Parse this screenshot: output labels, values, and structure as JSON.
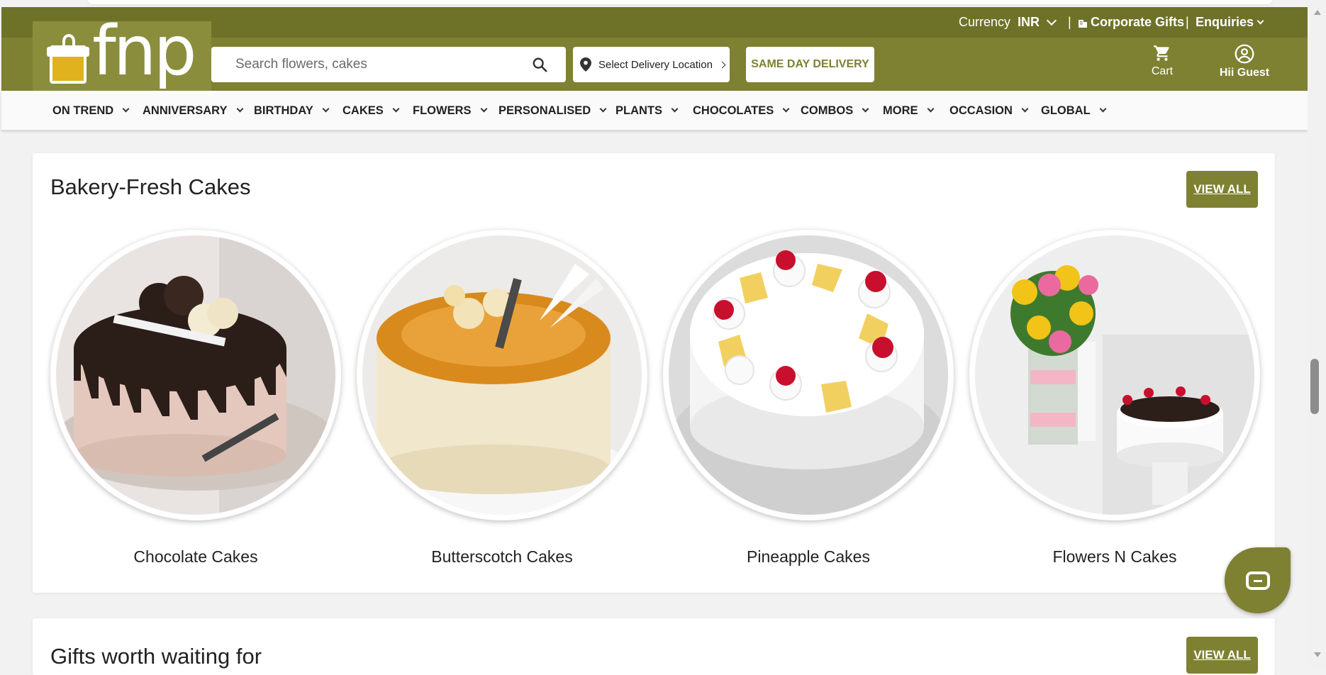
{
  "header": {
    "logo_text": "fnp",
    "currency_label": "Currency",
    "currency_value": "INR",
    "corporate_gifts": "Corporate Gifts",
    "enquiries": "Enquiries",
    "search_placeholder": "Search flowers, cakes",
    "location": "Select Delivery Location",
    "same_day": "SAME DAY DELIVERY",
    "cart": "Cart",
    "user": "Hii Guest"
  },
  "nav": {
    "items": [
      "ON TREND",
      "ANNIVERSARY",
      "BIRTHDAY",
      "CAKES",
      "FLOWERS",
      "PERSONALISED",
      "PLANTS",
      "CHOCOLATES",
      "COMBOS",
      "MORE",
      "OCCASION",
      "GLOBAL"
    ]
  },
  "section1": {
    "title": "Bakery-Fresh Cakes",
    "view_all": "VIEW ALL",
    "items": [
      {
        "name": "Chocolate Cakes"
      },
      {
        "name": "Butterscotch Cakes"
      },
      {
        "name": "Pineapple Cakes"
      },
      {
        "name": "Flowers N Cakes"
      }
    ]
  },
  "section2": {
    "title": "Gifts worth waiting for",
    "view_all": "VIEW ALL"
  },
  "colors": {
    "brand": "#7d8131",
    "brand_dark": "#6e7229",
    "logo_yellow": "#e0b21e"
  }
}
